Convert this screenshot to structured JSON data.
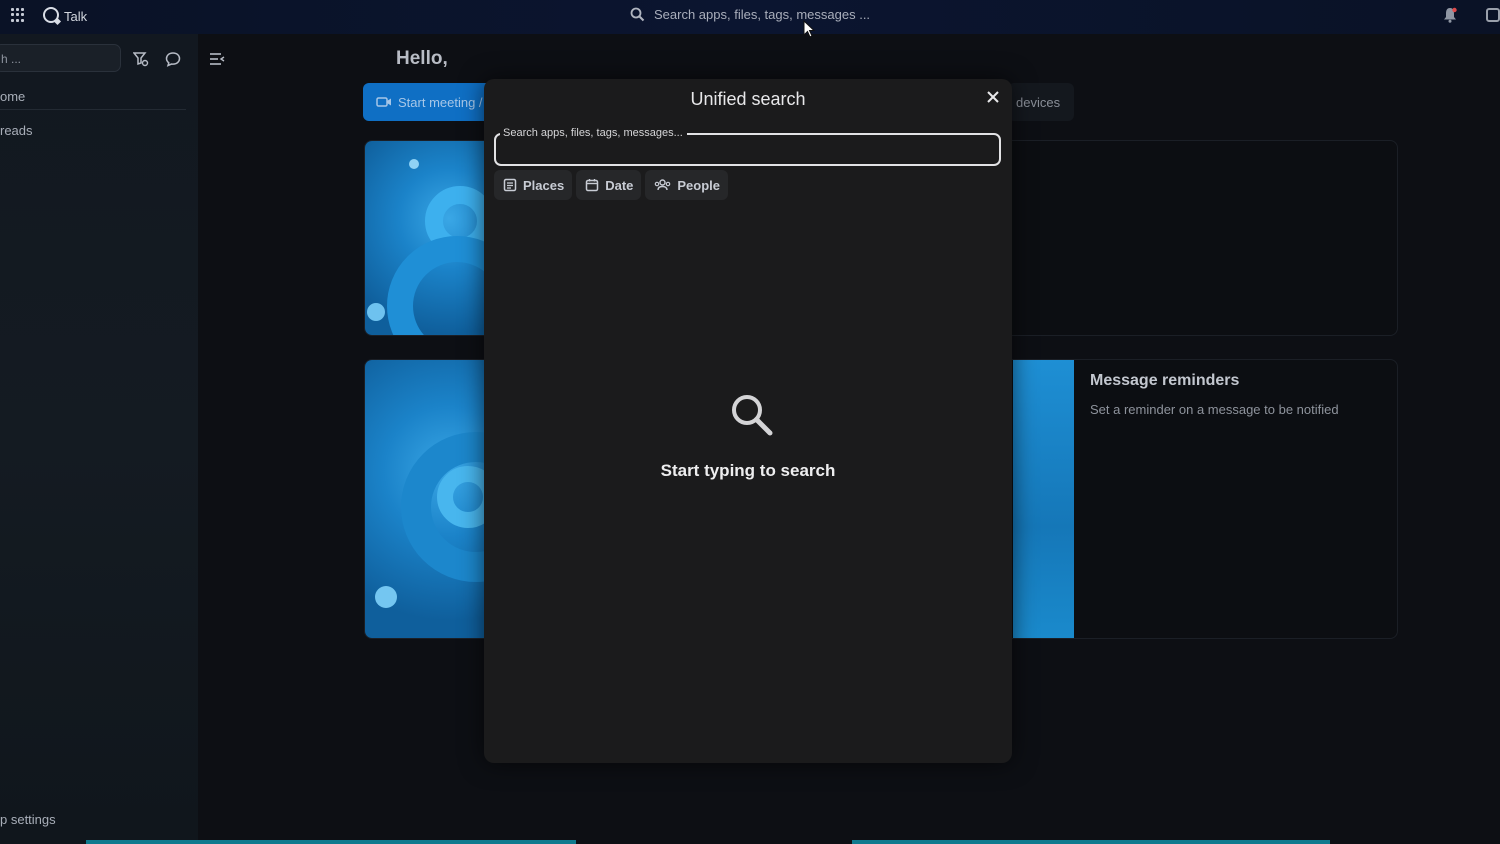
{
  "topbar": {
    "app_name": "Talk",
    "search_placeholder": "Search apps, files, tags, messages ...",
    "icons": [
      "apps-grid-icon",
      "talk-logo-icon",
      "search-icon",
      "notifications-icon",
      "user-menu-icon"
    ]
  },
  "sidebar": {
    "search_placeholder": "h ...",
    "items": [
      {
        "label": "ome"
      },
      {
        "label": "reads"
      }
    ],
    "settings_label": "p settings"
  },
  "main": {
    "greeting": "Hello,",
    "start_meeting_label": "Start meeting /",
    "devices_label": "devices",
    "reminder_card": {
      "title": "Message reminders",
      "subtitle": "Set a reminder on a message to be notified"
    }
  },
  "modal": {
    "title": "Unified search",
    "input_label": "Search apps, files, tags, messages...",
    "input_value": "",
    "filters": [
      {
        "label": "Places",
        "icon": "places-icon"
      },
      {
        "label": "Date",
        "icon": "calendar-icon"
      },
      {
        "label": "People",
        "icon": "people-icon"
      }
    ],
    "empty_state": "Start typing to search"
  },
  "colors": {
    "primary": "#0f6fc4",
    "modal_bg": "#1b1b1c",
    "page_bg": "#0d0f14"
  }
}
